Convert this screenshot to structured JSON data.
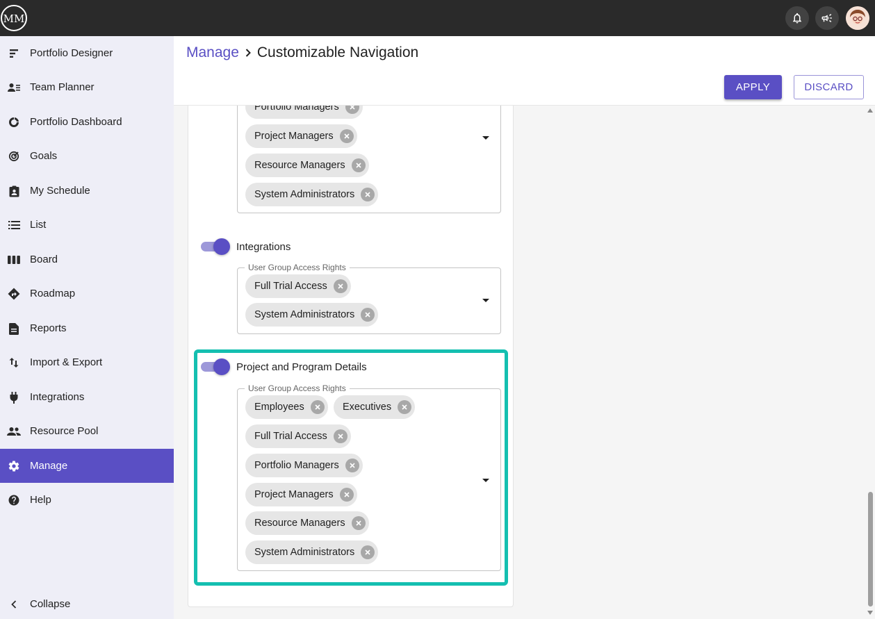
{
  "app": {
    "logo_text": "MM"
  },
  "sidebar": {
    "items": [
      {
        "label": "Portfolio Designer",
        "icon": "portfolio-designer-icon"
      },
      {
        "label": "Team Planner",
        "icon": "team-planner-icon"
      },
      {
        "label": "Portfolio Dashboard",
        "icon": "dashboard-icon"
      },
      {
        "label": "Goals",
        "icon": "goals-icon"
      },
      {
        "label": "My Schedule",
        "icon": "schedule-icon"
      },
      {
        "label": "List",
        "icon": "list-icon"
      },
      {
        "label": "Board",
        "icon": "board-icon"
      },
      {
        "label": "Roadmap",
        "icon": "roadmap-icon"
      },
      {
        "label": "Reports",
        "icon": "reports-icon"
      },
      {
        "label": "Import & Export",
        "icon": "import-export-icon"
      },
      {
        "label": "Integrations",
        "icon": "plug-icon"
      },
      {
        "label": "Resource Pool",
        "icon": "people-icon"
      },
      {
        "label": "Manage",
        "icon": "gear-icon",
        "active": true
      },
      {
        "label": "Help",
        "icon": "help-icon"
      }
    ],
    "collapse_label": "Collapse"
  },
  "breadcrumb": {
    "parent": "Manage",
    "current": "Customizable Navigation"
  },
  "toolbar": {
    "apply_label": "APPLY",
    "discard_label": "DISCARD"
  },
  "colors": {
    "accent": "#5a4fc4",
    "highlight": "#14bfb0",
    "topbar": "#2a2a2a",
    "sidebar": "#eeeef7"
  },
  "sections": [
    {
      "chips": [
        "Portfolio Managers",
        "Project Managers",
        "Resource Managers",
        "System Administrators"
      ]
    },
    {
      "title": "Integrations",
      "enabled": true,
      "field_label": "User Group Access Rights",
      "chips": [
        "Full Trial Access",
        "System Administrators"
      ]
    },
    {
      "title": "Project and Program Details",
      "enabled": true,
      "field_label": "User Group Access Rights",
      "chips": [
        "Employees",
        "Executives",
        "Full Trial Access",
        "Portfolio Managers",
        "Project Managers",
        "Resource Managers",
        "System Administrators"
      ]
    }
  ]
}
